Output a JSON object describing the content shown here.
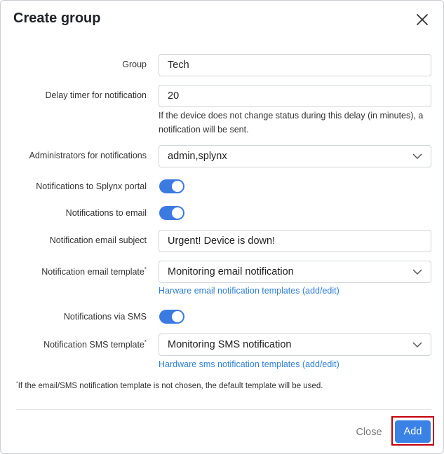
{
  "dialog": {
    "title": "Create group",
    "close_icon": "close-icon"
  },
  "form": {
    "group": {
      "label": "Group",
      "value": "Tech"
    },
    "delay_timer": {
      "label": "Delay timer for notification",
      "value": "20",
      "help_line1": "If the device does not change status during this delay (in minutes), a",
      "help_line2": "notification will be sent."
    },
    "administrators": {
      "label": "Administrators for notifications",
      "value": "admin,splynx"
    },
    "portal_notifications": {
      "label": "Notifications to Splynx portal",
      "enabled": true
    },
    "email_notifications": {
      "label": "Notifications to email",
      "enabled": true
    },
    "email_subject": {
      "label": "Notification email subject",
      "value": "Urgent! Device is down!"
    },
    "email_template": {
      "label": "Notification email template",
      "required_mark": "*",
      "value": "Monitoring email notification",
      "link": "Harware email notification templates (add/edit)"
    },
    "sms_notifications": {
      "label": "Notifications via SMS",
      "enabled": true
    },
    "sms_template": {
      "label": "Notification SMS template",
      "required_mark": "*",
      "value": "Monitoring SMS notification",
      "link": "Hardware sms notification templates (add/edit)"
    }
  },
  "footnote": {
    "mark": "*",
    "text": "If the email/SMS notification template is not chosen, the default template will be used."
  },
  "footer": {
    "close_label": "Close",
    "add_label": "Add"
  },
  "colors": {
    "accent": "#3b82e6",
    "toggle_on": "#3b7ae0",
    "link": "#2f80d6",
    "highlight_outline": "#c3000b"
  }
}
